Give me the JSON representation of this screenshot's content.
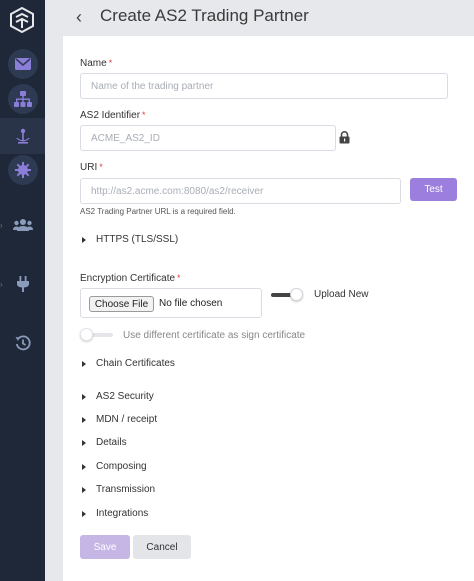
{
  "header": {
    "title": "Create AS2 Trading Partner"
  },
  "form": {
    "name": {
      "label": "Name",
      "required": "*",
      "placeholder": "Name of the trading partner"
    },
    "as2_identifier": {
      "label": "AS2 Identifier",
      "required": "*",
      "placeholder": "ACME_AS2_ID"
    },
    "uri": {
      "label": "URI",
      "required": "*",
      "placeholder": "http://as2.acme.com:8080/as2/receiver",
      "test_label": "Test",
      "help": "AS2 Trading Partner URL is a required field."
    },
    "https_section": "HTTPS (TLS/SSL)",
    "encryption": {
      "label": "Encryption Certificate",
      "required": "*",
      "choose_file": "Choose File",
      "no_file": "No file chosen",
      "upload_new": "Upload New",
      "sign_cert_label": "Use different certificate as sign certificate"
    },
    "sections": [
      "Chain Certificates",
      "AS2 Security",
      "MDN / receipt",
      "Details",
      "Composing",
      "Transmission",
      "Integrations"
    ],
    "save_label": "Save",
    "cancel_label": "Cancel"
  },
  "colors": {
    "sidebar": "#1f2838",
    "accent": "#9b7ede",
    "accent_disabled": "#c5b6e6",
    "icon": "#8b7ed8"
  },
  "icons": {
    "sidebar": [
      "logo-icon",
      "mail-icon",
      "sitemap-icon",
      "anchor-icon",
      "gear-icon",
      "users-icon",
      "plug-icon",
      "history-icon"
    ],
    "header": "chevron-left-icon",
    "lock": "lock-icon"
  }
}
